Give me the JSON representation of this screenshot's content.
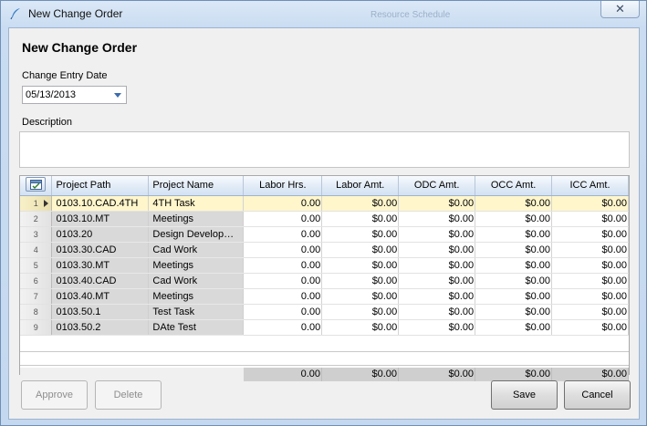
{
  "window": {
    "title": "New Change Order",
    "background_text": "Resource Schedule",
    "close_symbol": "✕"
  },
  "form": {
    "heading": "New Change Order",
    "entry_date_label": "Change Entry Date",
    "entry_date_value": "05/13/2013",
    "description_label": "Description",
    "description_value": ""
  },
  "grid": {
    "columns": [
      "Project Path",
      "Project Name",
      "Labor Hrs.",
      "Labor Amt.",
      "ODC Amt.",
      "OCC Amt.",
      "ICC Amt."
    ],
    "rows": [
      {
        "n": "1",
        "path": "0103.10.CAD.4TH",
        "name": "4TH Task",
        "labor_hrs": "0.00",
        "labor_amt": "$0.00",
        "odc": "$0.00",
        "occ": "$0.00",
        "icc": "$0.00"
      },
      {
        "n": "2",
        "path": "0103.10.MT",
        "name": "Meetings",
        "labor_hrs": "0.00",
        "labor_amt": "$0.00",
        "odc": "$0.00",
        "occ": "$0.00",
        "icc": "$0.00"
      },
      {
        "n": "3",
        "path": "0103.20",
        "name": "Design Develop…",
        "labor_hrs": "0.00",
        "labor_amt": "$0.00",
        "odc": "$0.00",
        "occ": "$0.00",
        "icc": "$0.00"
      },
      {
        "n": "4",
        "path": "0103.30.CAD",
        "name": "Cad Work",
        "labor_hrs": "0.00",
        "labor_amt": "$0.00",
        "odc": "$0.00",
        "occ": "$0.00",
        "icc": "$0.00"
      },
      {
        "n": "5",
        "path": "0103.30.MT",
        "name": "Meetings",
        "labor_hrs": "0.00",
        "labor_amt": "$0.00",
        "odc": "$0.00",
        "occ": "$0.00",
        "icc": "$0.00"
      },
      {
        "n": "6",
        "path": "0103.40.CAD",
        "name": "Cad Work",
        "labor_hrs": "0.00",
        "labor_amt": "$0.00",
        "odc": "$0.00",
        "occ": "$0.00",
        "icc": "$0.00"
      },
      {
        "n": "7",
        "path": "0103.40.MT",
        "name": "Meetings",
        "labor_hrs": "0.00",
        "labor_amt": "$0.00",
        "odc": "$0.00",
        "occ": "$0.00",
        "icc": "$0.00"
      },
      {
        "n": "8",
        "path": "0103.50.1",
        "name": "Test Task",
        "labor_hrs": "0.00",
        "labor_amt": "$0.00",
        "odc": "$0.00",
        "occ": "$0.00",
        "icc": "$0.00"
      },
      {
        "n": "9",
        "path": "0103.50.2",
        "name": "DAte Test",
        "labor_hrs": "0.00",
        "labor_amt": "$0.00",
        "odc": "$0.00",
        "occ": "$0.00",
        "icc": "$0.00"
      }
    ],
    "totals": {
      "labor_hrs": "0.00",
      "labor_amt": "$0.00",
      "odc": "$0.00",
      "occ": "$0.00",
      "icc": "$0.00"
    }
  },
  "buttons": {
    "approve": "Approve",
    "delete": "Delete",
    "save": "Save",
    "cancel": "Cancel"
  },
  "icons": {
    "title": "feather-pen-icon",
    "date_dropdown": "chevron-down-icon",
    "grid_corner": "column-chooser-icon",
    "current_row": "row-pointer-icon"
  },
  "colors": {
    "title_bar": "#c9dcf1",
    "selected_row": "#fff6cc",
    "readonly_cell": "#d9d9d9"
  }
}
